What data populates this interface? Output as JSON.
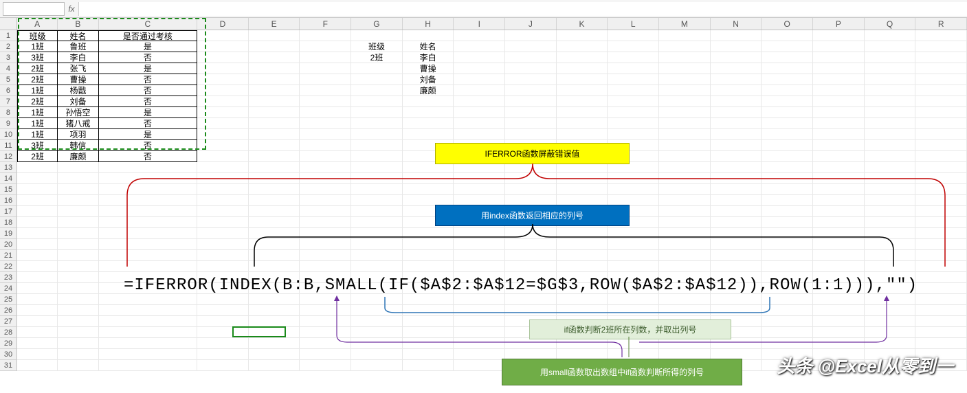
{
  "namebox": "",
  "columns": [
    "A",
    "B",
    "C",
    "D",
    "E",
    "F",
    "G",
    "H",
    "I",
    "J",
    "K",
    "L",
    "M",
    "N",
    "O",
    "P",
    "Q",
    "R"
  ],
  "row_count": 31,
  "table": {
    "headers": {
      "A": "班级",
      "B": "姓名",
      "C": "是否通过考核"
    },
    "rows": [
      {
        "A": "1班",
        "B": "鲁班",
        "C": "是"
      },
      {
        "A": "3班",
        "B": "李白",
        "C": "否"
      },
      {
        "A": "2班",
        "B": "张飞",
        "C": "是"
      },
      {
        "A": "2班",
        "B": "曹操",
        "C": "否"
      },
      {
        "A": "1班",
        "B": "杨戬",
        "C": "否"
      },
      {
        "A": "2班",
        "B": "刘备",
        "C": "否"
      },
      {
        "A": "1班",
        "B": "孙悟空",
        "C": "是"
      },
      {
        "A": "1班",
        "B": "猪八戒",
        "C": "否"
      },
      {
        "A": "1班",
        "B": "项羽",
        "C": "是"
      },
      {
        "A": "3班",
        "B": "韩信",
        "C": "否"
      },
      {
        "A": "2班",
        "B": "廉颇",
        "C": "否"
      }
    ]
  },
  "lookup": {
    "hdr_class": "班级",
    "hdr_name": "姓名",
    "class_val": "2班",
    "results": [
      "李白",
      "曹操",
      "刘备",
      "廉颇"
    ]
  },
  "callouts": {
    "yellow": "IFERROR函数屏蔽错误值",
    "blue": "用index函数返回相应的列号",
    "olive": "if函数判断2班所在列数，并取出列号",
    "green": "用small函数取出数组中if函数判断所得的列号"
  },
  "formula": "=IFERROR(INDEX(B:B,SMALL(IF($A$2:$A$12=$G$3,ROW($A$2:$A$12)),ROW(1:1))),\"\")",
  "watermark": "头条 @Excel从零到一",
  "colors": {
    "yellow": "#ffff00",
    "blue": "#0070c0",
    "olive": "#e2efda",
    "green": "#70ad47",
    "marquee": "#1a8a1a"
  }
}
